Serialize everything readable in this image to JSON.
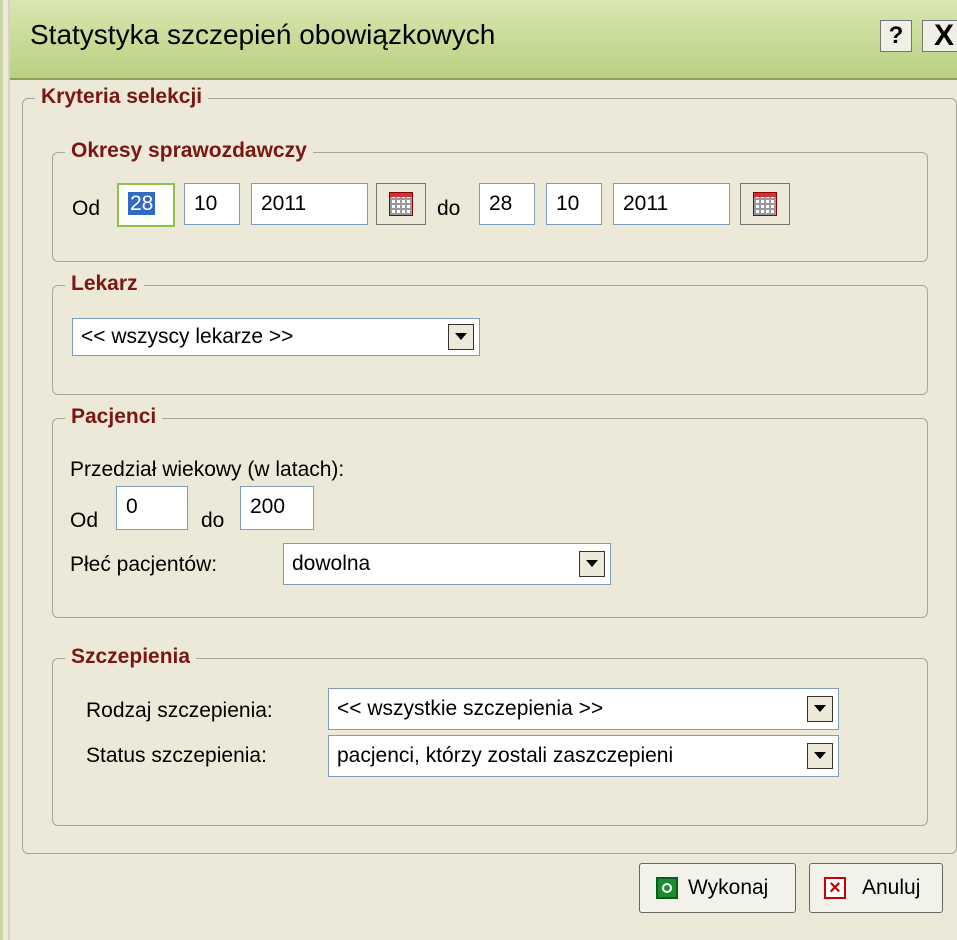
{
  "window": {
    "title": "Statystyka szczepień obowiązkowych",
    "help_label": "?",
    "close_label": "X"
  },
  "criteria": {
    "legend": "Kryteria selekcji"
  },
  "period": {
    "legend": "Okresy sprawozdawczy",
    "from_label": "Od",
    "from_day": "28",
    "from_month": "10",
    "from_year": "2011",
    "to_label": "do",
    "to_day": "28",
    "to_month": "10",
    "to_year": "2011"
  },
  "doctor": {
    "legend": "Lekarz",
    "selected": "<< wszyscy lekarze >>"
  },
  "patients": {
    "legend": "Pacjenci",
    "age_range_label": "Przedział wiekowy (w latach):",
    "from_label": "Od",
    "age_from": "0",
    "to_label": "do",
    "age_to": "200",
    "sex_label": "Płeć pacjentów:",
    "sex_selected": "dowolna"
  },
  "vaccinations": {
    "legend": "Szczepienia",
    "type_label": "Rodzaj szczepienia:",
    "type_selected": "<< wszystkie szczepienia >>",
    "status_label": "Status szczepienia:",
    "status_selected": "pacjenci, którzy zostali zaszczepieni"
  },
  "buttons": {
    "run_label": "Wykonaj",
    "cancel_label": "Anuluj"
  },
  "icons": {
    "calendar": "calendar-icon",
    "dropdown": "chevron-down-icon",
    "run": "ok-icon",
    "cancel": "close-icon",
    "help": "help-icon"
  },
  "colors": {
    "title_bar": "#c7da95",
    "legend_text": "#7a1713",
    "background": "#ece9d8"
  }
}
